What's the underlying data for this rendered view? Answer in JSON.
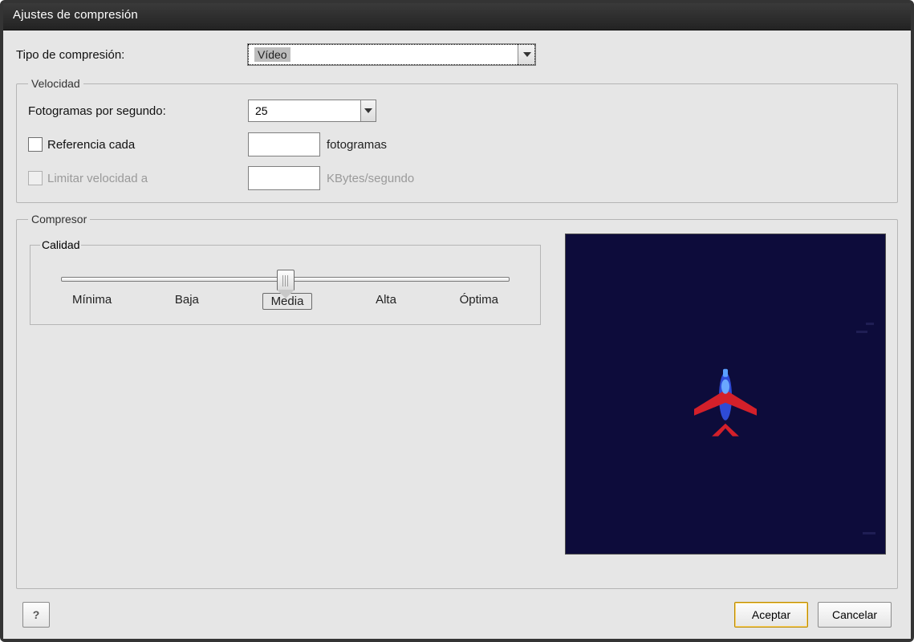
{
  "title": "Ajustes de compresión",
  "compressionType": {
    "label": "Tipo de compresión:",
    "value": "Vídeo"
  },
  "speed": {
    "legend": "Velocidad",
    "fpsLabel": "Fotogramas por segundo:",
    "fpsValue": "25",
    "keyframe": {
      "checked": false,
      "label": "Referencia cada",
      "value": "",
      "suffix": "fotogramas"
    },
    "limit": {
      "enabled": false,
      "label": "Limitar velocidad a",
      "value": "",
      "suffix": "KBytes/segundo"
    }
  },
  "compressor": {
    "legend": "Compresor",
    "quality": {
      "legend": "Calidad",
      "ticks": [
        "Mínima",
        "Baja",
        "Media",
        "Alta",
        "Óptima"
      ],
      "selectedIndex": 2
    }
  },
  "buttons": {
    "help": "?",
    "ok": "Aceptar",
    "cancel": "Cancelar"
  }
}
